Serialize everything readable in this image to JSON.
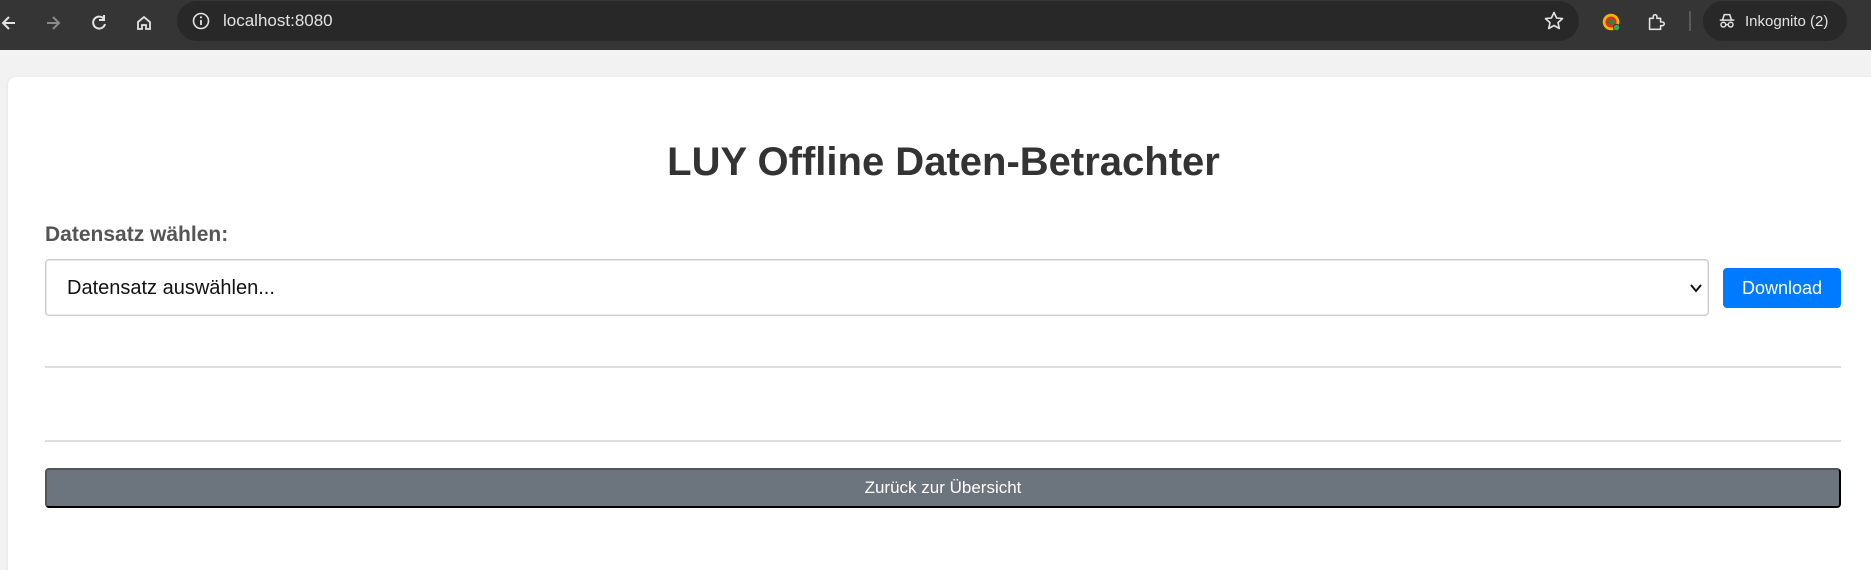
{
  "browser": {
    "url": "localhost:8080",
    "incognito_label": "Inkognito (2)",
    "icons": {
      "back": "arrow-left-icon",
      "forward": "arrow-right-icon",
      "reload": "reload-icon",
      "home": "home-icon",
      "site_info": "info-icon",
      "bookmark": "star-icon",
      "extension_a": "extension-colorful-icon",
      "extensions": "puzzle-icon",
      "incognito": "incognito-icon"
    }
  },
  "page": {
    "title": "LUY Offline Daten-Betrachter",
    "dataset_label": "Datensatz wählen:",
    "dataset_select": {
      "selected": "Datensatz auswählen..."
    },
    "download_label": "Download",
    "back_label": "Zurück zur Übersicht"
  },
  "colors": {
    "primary": "#007bff",
    "secondary": "#6c757d",
    "title": "#333333",
    "label": "#555555"
  }
}
